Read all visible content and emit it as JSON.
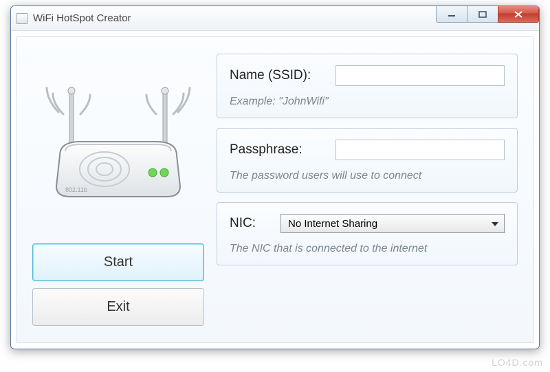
{
  "window": {
    "title": "WiFi HotSpot Creator"
  },
  "buttons": {
    "start": "Start",
    "exit": "Exit"
  },
  "ssid": {
    "label": "Name (SSID):",
    "value": "",
    "hint": "Example: \"JohnWifi\""
  },
  "passphrase": {
    "label": "Passphrase:",
    "value": "",
    "hint": "The password users will use to connect"
  },
  "nic": {
    "label": "NIC:",
    "selected": "No Internet Sharing",
    "hint": "The NIC that is connected to the internet"
  },
  "watermark": "LO4D.com"
}
